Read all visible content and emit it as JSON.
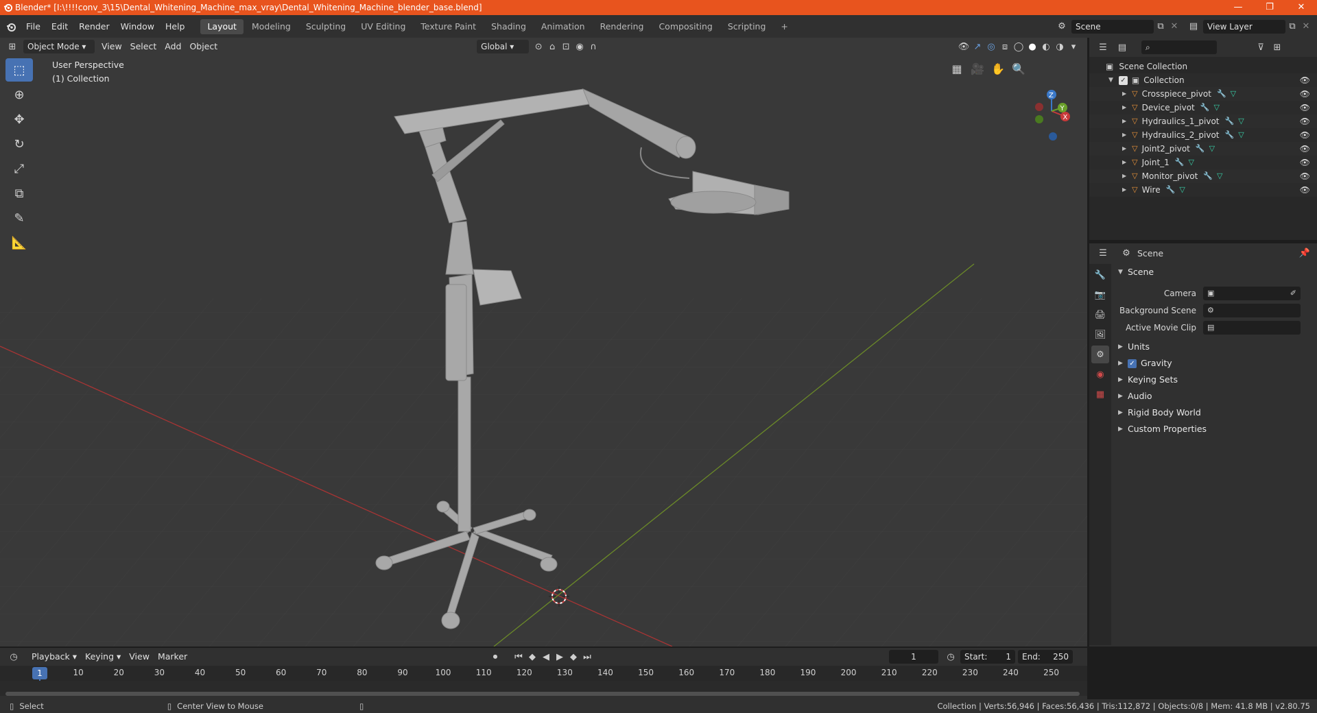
{
  "window": {
    "title": "Blender* [I:\\!!!!conv_3\\15\\Dental_Whitening_Machine_max_vray\\Dental_Whitening_Machine_blender_base.blend]",
    "controls": [
      "—",
      "❐",
      "✕"
    ]
  },
  "menu": [
    "File",
    "Edit",
    "Render",
    "Window",
    "Help"
  ],
  "workspaces": [
    "Layout",
    "Modeling",
    "Sculpting",
    "UV Editing",
    "Texture Paint",
    "Shading",
    "Animation",
    "Rendering",
    "Compositing",
    "Scripting"
  ],
  "active_workspace": "Layout",
  "scene_field": "Scene",
  "view_layer_field": "View Layer",
  "viewport": {
    "mode": "Object Mode",
    "menus": [
      "View",
      "Select",
      "Add",
      "Object"
    ],
    "orientation": "Global",
    "info_line1": "User Perspective",
    "info_line2": "(1) Collection"
  },
  "outliner": {
    "root": "Scene Collection",
    "collection": "Collection",
    "objects": [
      "Crosspiece_pivot",
      "Device_pivot",
      "Hydraulics_1_pivot",
      "Hydraulics_2_pivot",
      "Joint2_pivot",
      "Joint_1",
      "Monitor_pivot",
      "Wire"
    ]
  },
  "properties": {
    "header": "Scene",
    "panel": "Scene",
    "camera_label": "Camera",
    "bg_scene_label": "Background Scene",
    "movie_clip_label": "Active Movie Clip",
    "subpanels": [
      "Units",
      "Gravity",
      "Keying Sets",
      "Audio",
      "Rigid Body World",
      "Custom Properties"
    ],
    "gravity_checked": true
  },
  "timeline": {
    "menus": [
      "Playback",
      "Keying",
      "View",
      "Marker"
    ],
    "current_frame": "1",
    "start_label": "Start:",
    "start": "1",
    "end_label": "End:",
    "end": "250",
    "ruler": [
      "1",
      "10",
      "20",
      "30",
      "40",
      "50",
      "60",
      "70",
      "80",
      "90",
      "100",
      "110",
      "120",
      "130",
      "140",
      "150",
      "160",
      "170",
      "180",
      "190",
      "200",
      "210",
      "220",
      "230",
      "240",
      "250"
    ]
  },
  "status": {
    "left_action": "Select",
    "mid_action": "Center View to Mouse",
    "stats": "Collection | Verts:56,946 | Faces:56,436 | Tris:112,872 | Objects:0/8 | Mem: 41.8 MB | v2.80.75"
  },
  "colors": {
    "titlebar": "#e8541e",
    "accent": "#4772b3",
    "object_icon": "#e8923a",
    "mesh_icon": "#38d0a8",
    "x_axis": "#b43c3c",
    "y_axis": "#7a9a2a"
  }
}
